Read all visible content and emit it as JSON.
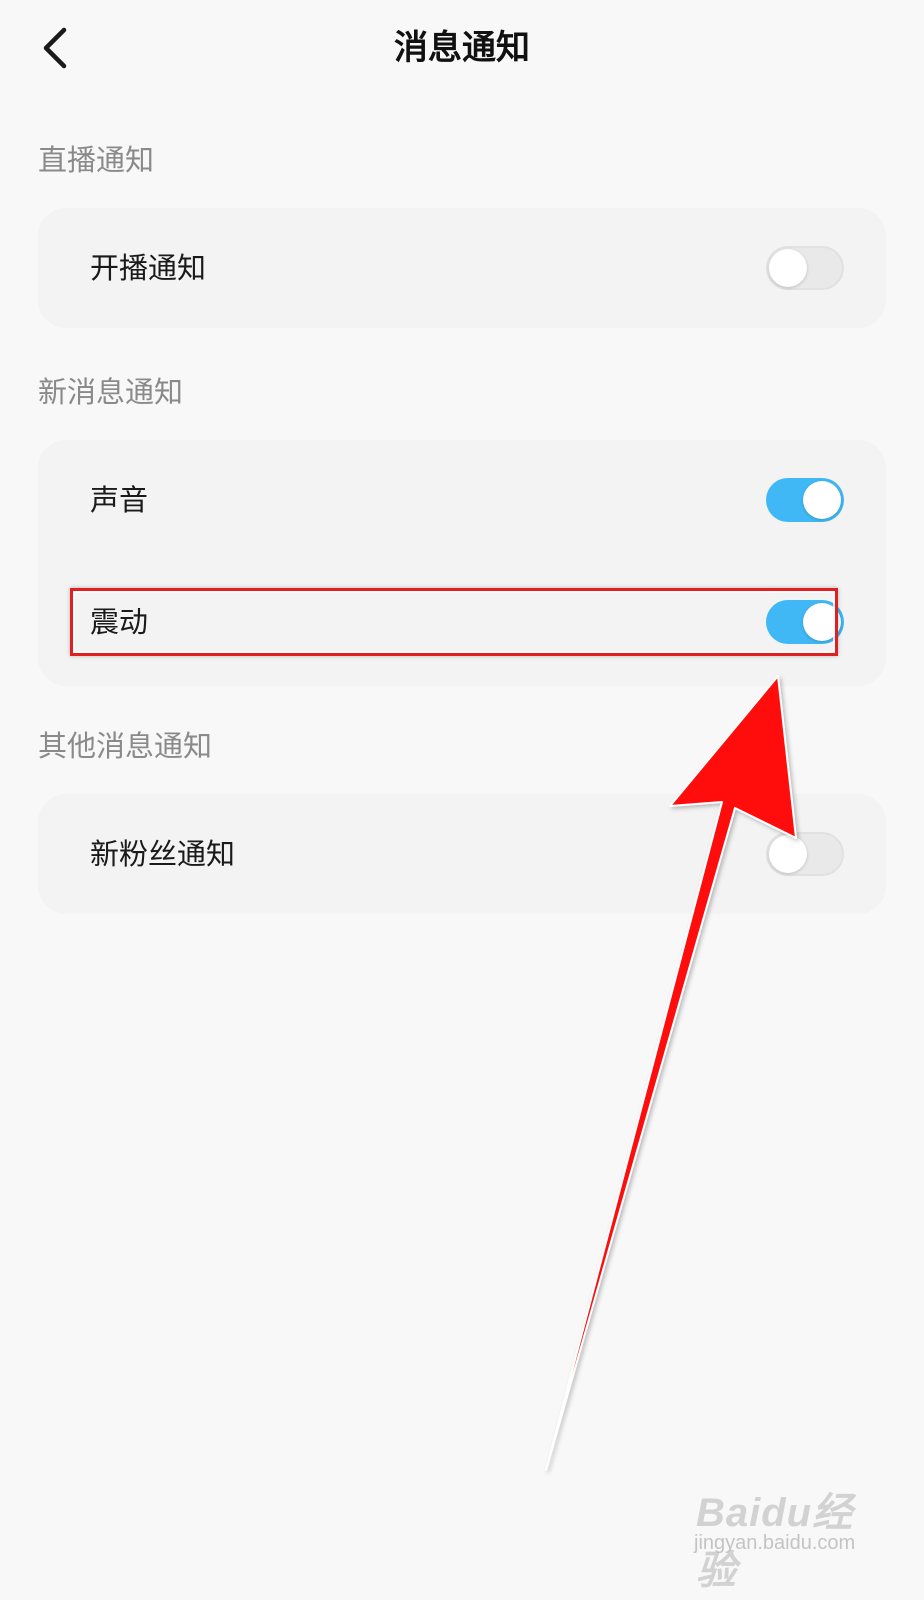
{
  "header": {
    "title": "消息通知",
    "back_icon": "chevron-left-icon"
  },
  "sections": [
    {
      "title": "直播通知",
      "items": [
        {
          "label": "开播通知",
          "enabled": false
        }
      ]
    },
    {
      "title": "新消息通知",
      "items": [
        {
          "label": "声音",
          "enabled": true
        },
        {
          "label": "震动",
          "enabled": true
        }
      ]
    },
    {
      "title": "其他消息通知",
      "items": [
        {
          "label": "新粉丝通知",
          "enabled": false
        }
      ]
    }
  ],
  "colors": {
    "toggle_on": "#3fb8f5",
    "toggle_off": "#e9e9e9",
    "annotation": "#e02020"
  },
  "watermark": {
    "logo": "Baidu经验",
    "url": "jingyan.baidu.com"
  }
}
